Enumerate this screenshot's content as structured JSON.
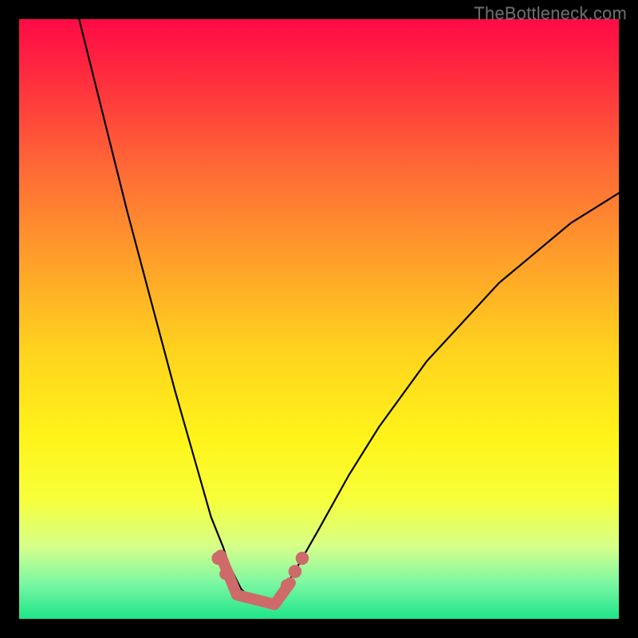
{
  "watermark": "TheBottleneck.com",
  "chart_data": {
    "type": "line",
    "title": "",
    "xlabel": "",
    "ylabel": "",
    "xlim": [
      0,
      100
    ],
    "ylim": [
      0,
      100
    ],
    "series": [
      {
        "name": "bottleneck-curve",
        "x": [
          10,
          14,
          18,
          22,
          26,
          30,
          32,
          34,
          35,
          36,
          37,
          38,
          39,
          40,
          41,
          42,
          43,
          44,
          46,
          50,
          55,
          60,
          68,
          80,
          92,
          100
        ],
        "y": [
          100,
          84,
          68,
          53,
          38,
          24,
          17,
          12,
          9,
          7,
          5,
          4,
          3.2,
          2.6,
          2.4,
          2.6,
          3.4,
          4.8,
          8,
          15,
          24,
          32,
          43,
          56,
          66,
          71
        ]
      }
    ],
    "markers": [
      {
        "name": "dot-left-upper",
        "x": 33.2,
        "y": 10.1,
        "r": 1.1
      },
      {
        "name": "dot-left-lower",
        "x": 34.4,
        "y": 7.5,
        "r": 1.0
      },
      {
        "name": "dot-right-1",
        "x": 44.6,
        "y": 5.6,
        "r": 1.0
      },
      {
        "name": "dot-right-2",
        "x": 46.0,
        "y": 7.9,
        "r": 1.1
      },
      {
        "name": "dot-right-3",
        "x": 47.2,
        "y": 10.1,
        "r": 1.1
      }
    ],
    "thick_segments": [
      {
        "name": "seg-left",
        "x1": 33.6,
        "y1": 10.6,
        "x2": 36.3,
        "y2": 4.0
      },
      {
        "name": "seg-bottom",
        "x1": 36.3,
        "y1": 4.0,
        "x2": 42.6,
        "y2": 2.4
      },
      {
        "name": "seg-right",
        "x1": 42.6,
        "y1": 2.4,
        "x2": 45.2,
        "y2": 6.0
      }
    ],
    "colors": {
      "curve": "#000000",
      "overlay": "#cf6a6a"
    }
  }
}
